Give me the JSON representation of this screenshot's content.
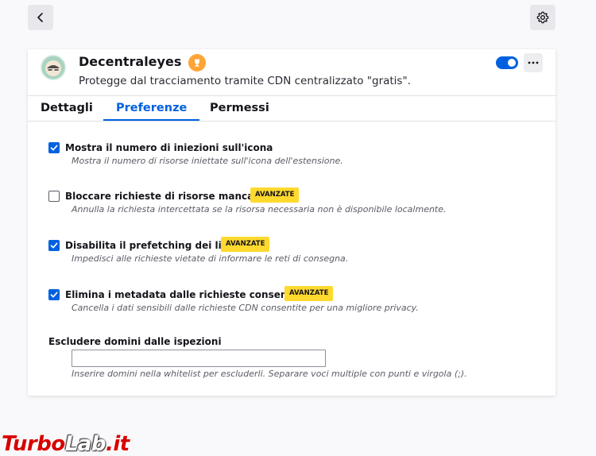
{
  "toolbar": {
    "back_icon": "chevron-left-icon",
    "settings_icon": "gear-icon"
  },
  "addon": {
    "name": "Decentraleyes",
    "description": "Protegge dal tracciamento tramite CDN centralizzato \"gratis\".",
    "recommended_icon": "trophy-icon",
    "enabled": true,
    "more_icon": "ellipsis-icon"
  },
  "tabs": [
    {
      "label": "Dettagli",
      "selected": false
    },
    {
      "label": "Preferenze",
      "selected": true
    },
    {
      "label": "Permessi",
      "selected": false
    }
  ],
  "preferences": [
    {
      "label": "Mostra il numero di iniezioni sull'icona",
      "description": "Mostra il numero di risorse iniettate sull'icona dell'estensione.",
      "checked": true,
      "badge": ""
    },
    {
      "label": "Bloccare richieste di risorse mancanti",
      "description": "Annulla la richiesta intercettata se la risorsa necessaria non è disponibile localmente.",
      "checked": false,
      "badge": "AVANZATE"
    },
    {
      "label": "Disabilita il prefetching dei link",
      "description": "Impedisci alle richieste vietate di informare le reti di consegna.",
      "checked": true,
      "badge": "AVANZATE"
    },
    {
      "label": "Elimina i metadata dalle richieste consentite",
      "description": "Cancella i dati sensibili dalle richieste CDN consentite per una migliore privacy.",
      "checked": true,
      "badge": "AVANZATE"
    }
  ],
  "exclude": {
    "label": "Escludere domini dalle ispezioni",
    "value": "",
    "help": "Inserire domini nella whitelist per escluderli. Separare voci multiple con punti e virgola (;)."
  },
  "watermark": {
    "part1": "Turbo",
    "part2": "Lab",
    "part3": ".it"
  },
  "colors": {
    "accent": "#0061e0",
    "badge": "#ffd92e",
    "trophy": "#ffa436"
  }
}
